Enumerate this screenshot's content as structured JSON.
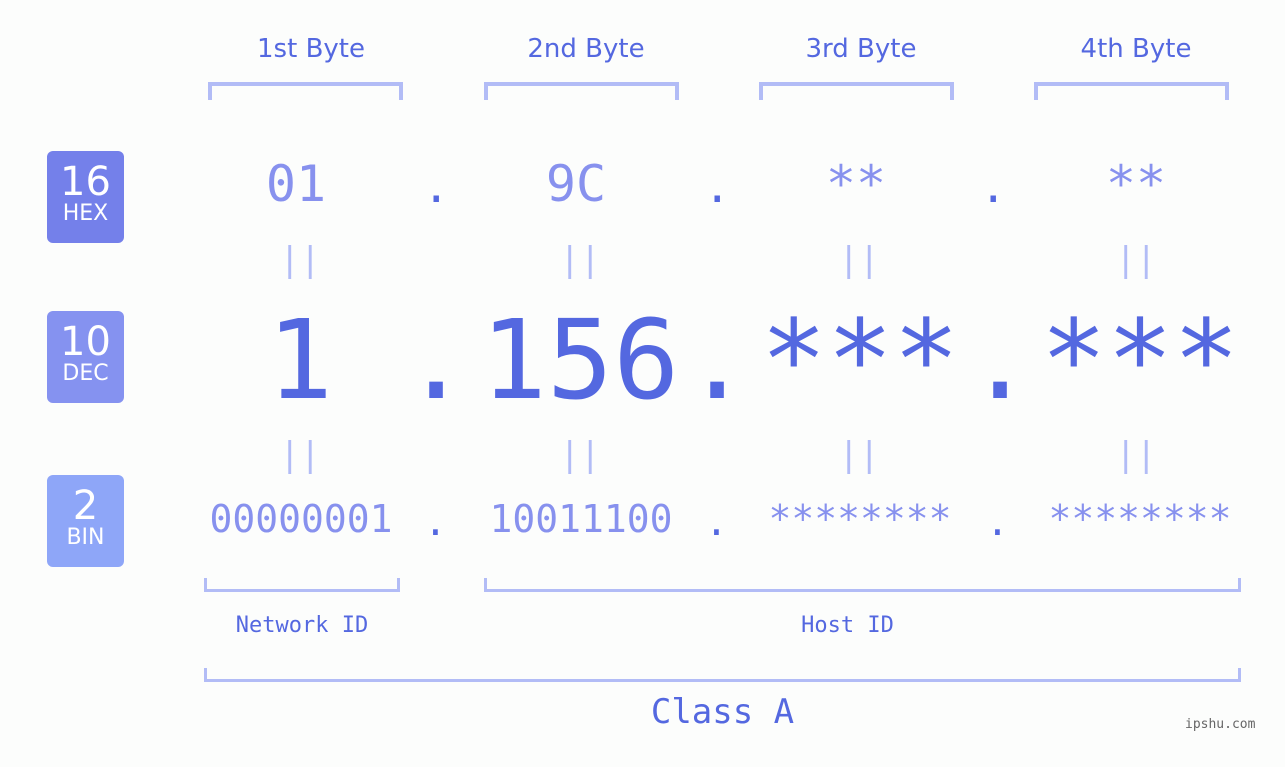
{
  "headers": [
    "1st Byte",
    "2nd Byte",
    "3rd Byte",
    "4th Byte"
  ],
  "rows": {
    "hex": {
      "base": "16",
      "label": "HEX",
      "values": [
        "01",
        "9C",
        "**",
        "**"
      ],
      "color": "#7480ea"
    },
    "dec": {
      "base": "10",
      "label": "DEC",
      "values": [
        "1",
        "156",
        "***",
        "***"
      ],
      "color": "#8592f0"
    },
    "bin": {
      "base": "2",
      "label": "BIN",
      "values": [
        "00000001",
        "10011100",
        "********",
        "********"
      ],
      "color": "#8ea6f8"
    }
  },
  "separator": ".",
  "equals": "||",
  "network_label": "Network ID",
  "host_label": "Host ID",
  "class_label": "Class A",
  "watermark": "ipshu.com"
}
